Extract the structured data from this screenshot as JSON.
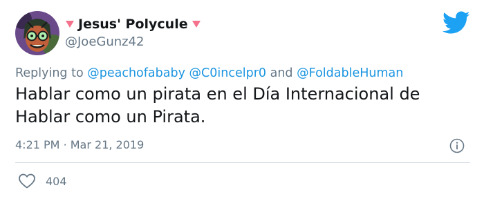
{
  "author": {
    "display_name": "Jesus' Polycule",
    "handle": "@JoeGunz42"
  },
  "reply": {
    "prefix": "Replying to",
    "mentions": [
      "@peachofababy",
      "@C0incelpr0",
      "@FoldableHuman"
    ],
    "joiner": "and"
  },
  "tweet": {
    "text": "Hablar como un pirata en el Día Internacional de Hablar como un Pirata.",
    "time": "4:21 PM",
    "separator": "·",
    "date": "Mar 21, 2019"
  },
  "engagement": {
    "likes": "404"
  },
  "icons": {
    "brand": "twitter-bird-icon",
    "info": "info-icon",
    "like": "heart-outline-icon",
    "name_decoration": "pink-heart-icon"
  },
  "colors": {
    "brand_blue": "#1da1f2",
    "mention_blue": "#1b95e0",
    "secondary_text": "#657786",
    "primary_text": "#14171a",
    "heart_pink": "#f4728c",
    "divider": "#ccd6dd"
  }
}
